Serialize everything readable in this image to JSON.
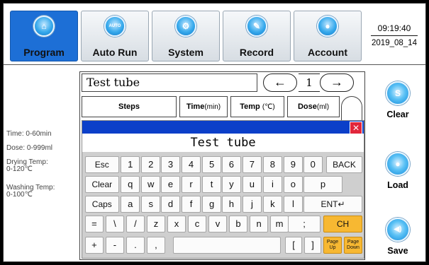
{
  "nav": {
    "program": {
      "label": "Program",
      "icon": "home-icon"
    },
    "auto_run": {
      "label": "Auto Run",
      "icon": "auto-icon",
      "icon_text": "AUTO"
    },
    "system": {
      "label": "System",
      "icon": "gear-icon"
    },
    "record": {
      "label": "Record",
      "icon": "pencil-icon"
    },
    "account": {
      "label": "Account",
      "icon": "user-icon"
    },
    "active": "Program"
  },
  "clock": {
    "time": "09:19:40",
    "date": "2019_08_14"
  },
  "info": {
    "time_range": "Time: 0-60min",
    "dose_range": "Dose: 0-999ml",
    "drying_label": "Drying Temp:",
    "drying_range": "0-120℃",
    "washing_label": "Washing Temp:",
    "washing_range": "0-100℃"
  },
  "program": {
    "name": "Test tube",
    "page": "1",
    "prev_glyph": "←",
    "next_glyph": "→",
    "columns": {
      "steps": "Steps",
      "time": "Time",
      "time_unit": "(min)",
      "temp": "Temp",
      "temp_unit": "(℃)",
      "dose": "Dose",
      "dose_unit": "(ml)"
    }
  },
  "keyboard": {
    "input_value": "Test tube",
    "close_glyph": "×",
    "row1": [
      "Esc",
      "1",
      "2",
      "3",
      "4",
      "5",
      "6",
      "7",
      "8",
      "9",
      "0",
      "BACK"
    ],
    "row2": [
      "Clear",
      "q",
      "w",
      "e",
      "r",
      "t",
      "y",
      "u",
      "i",
      "o",
      "p"
    ],
    "row3": [
      "Caps",
      "a",
      "s",
      "d",
      "f",
      "g",
      "h",
      "j",
      "k",
      "l",
      "ENT↵"
    ],
    "row4": [
      "=",
      "\\",
      "/",
      "z",
      "x",
      "c",
      "v",
      "b",
      "n",
      "m",
      ";",
      "CH"
    ],
    "row5": [
      "+",
      "-",
      ".",
      ",",
      "",
      "[",
      "]",
      "Page Up",
      "Page Down"
    ]
  },
  "side": {
    "clear": {
      "label": "Clear",
      "icon_text": "S"
    },
    "load": {
      "label": "Load",
      "icon_text": "●"
    },
    "save": {
      "label": "Save",
      "icon_text": "◀)"
    }
  },
  "colors": {
    "accent": "#1d6fd6",
    "kb_bar": "#0b3fc9",
    "orange_key": "#f7b832",
    "close": "#e1263b"
  }
}
